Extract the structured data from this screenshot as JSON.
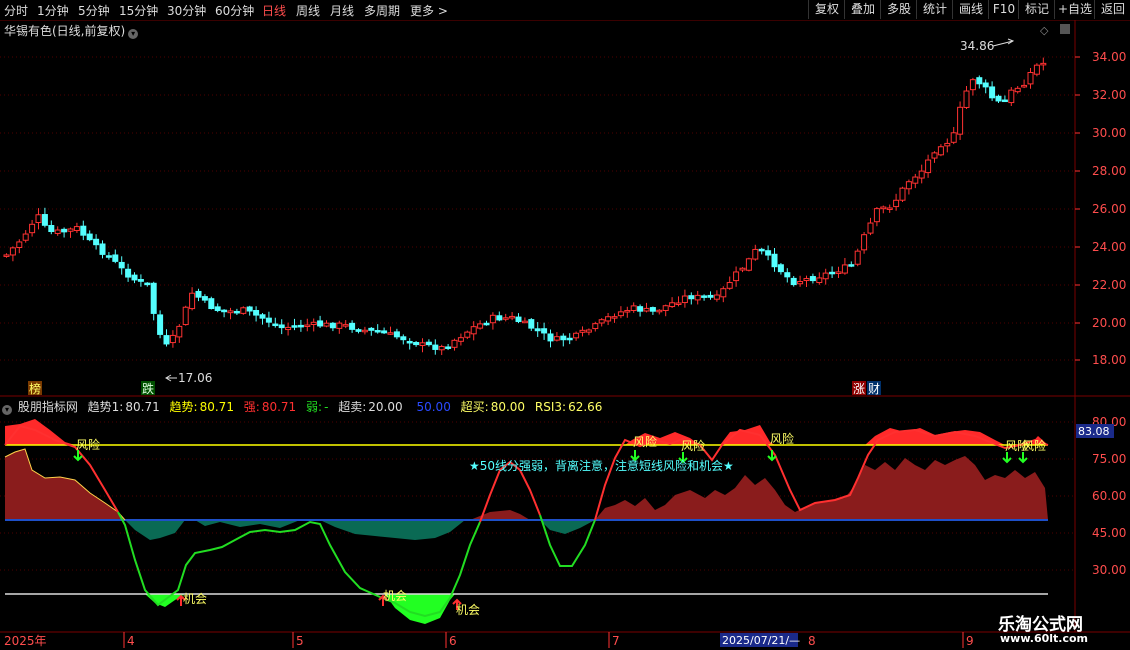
{
  "toolbar": {
    "periods": [
      "分时",
      "1分钟",
      "5分钟",
      "15分钟",
      "30分钟",
      "60分钟",
      "日线",
      "周线",
      "月线",
      "多周期",
      "更多 >"
    ],
    "active_period": "日线",
    "right_buttons": [
      "复权",
      "叠加",
      "多股",
      "统计",
      "画线",
      "F10",
      "标记",
      "+自选",
      "返回"
    ]
  },
  "stock": {
    "title": "华锡有色(日线,前复权)"
  },
  "price_axis": {
    "ticks": [
      "34.00",
      "32.00",
      "30.00",
      "28.00",
      "26.00",
      "24.00",
      "22.00",
      "20.00",
      "18.00"
    ]
  },
  "price_annotations": {
    "high": "34.86",
    "low": "17.06"
  },
  "markers": {
    "bang": "榜",
    "die": "跌",
    "zhang": "涨",
    "cai": "财"
  },
  "indicator": {
    "name": "股朋指标网",
    "trend1_label": "趋势1:",
    "trend1_value": "80.71",
    "trend_label": "趋势:",
    "trend_value": "80.71",
    "strong_label": "强:",
    "strong_value": "80.71",
    "weak_label": "弱:",
    "weak_value": "-",
    "oversold_label": "超卖:",
    "oversold_value": "20.00",
    "mid_value": "50.00",
    "overbought_label": "超买:",
    "overbought_value": "80.00",
    "rsi_label": "RSI3:",
    "rsi_value": "62.66",
    "current_badge": "83.08",
    "axis_ticks": [
      "80.00",
      "75.00",
      "60.00",
      "45.00",
      "30.00"
    ],
    "notice": "★50线分强弱，背离注意，注意短线风险和机会★",
    "risk_label": "风险",
    "opportunity_label": "机会"
  },
  "date_axis": {
    "labels": [
      "2025年",
      "4",
      "5",
      "6",
      "7",
      "8",
      "9"
    ],
    "cursor_date": "2025/07/21/—"
  },
  "colors": {
    "up": "#ff3232",
    "down": "#54ffff",
    "yellow": "#ffff00",
    "green": "#00e000",
    "red_fill": "#c00000"
  },
  "watermark": {
    "title": "乐淘公式网",
    "url": "www.60lt.com"
  }
}
